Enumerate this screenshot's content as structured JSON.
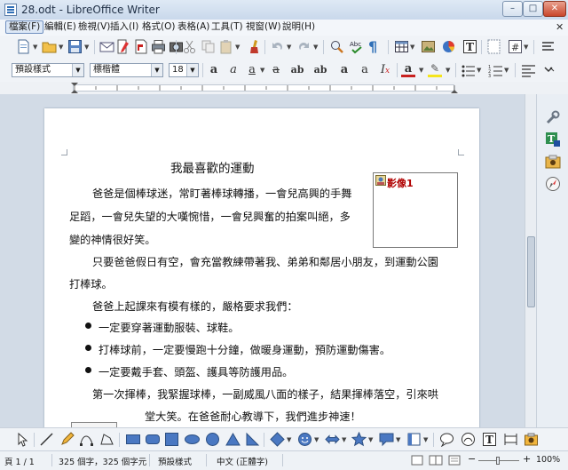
{
  "window": {
    "title": "28.odt - LibreOffice Writer",
    "controls": {
      "minimize": "–",
      "maximize": "□",
      "close": "✕"
    },
    "doc_close": "✕"
  },
  "menu": [
    "檔案(F)",
    "編輯(E)",
    "檢視(V)",
    "插入(I)",
    "格式(O)",
    "表格(A)",
    "工具(T)",
    "視窗(W)",
    "說明(H)"
  ],
  "formatting": {
    "paragraph_style": "預設樣式",
    "font_name": "標楷體",
    "font_size": "18"
  },
  "document": {
    "title": "我最喜歡的運動",
    "lines": [
      "爸爸是個棒球迷，常盯著棒球轉播，一會兒高興的手舞",
      "足蹈，一會兒失望的大嘆惋惜，一會兒興奮的拍案叫絕，多",
      "變的神情很好笑。",
      "只要爸爸假日有空，會充當教練帶著我、弟弟和鄰居小朋友，到運動公園",
      "打棒球。",
      "爸爸上起課來有模有樣的，嚴格要求我們：",
      "一定要穿著運動服裝、球鞋。",
      "打棒球前，一定要慢跑十分鐘，做暖身運動，預防運動傷害。",
      "一定要戴手套、頭盔、護具等防護用品。",
      "第一次揮棒，我緊握球棒，一副威風八面的樣子，結果揮棒落空，引來哄",
      "堂大笑。在爸爸耐心教導下，我們進步神速！"
    ],
    "frame_label": "影像1"
  },
  "status": {
    "page": "頁 1 / 1",
    "word_count": "325 個字，325 個字元",
    "page_style": "預設樣式",
    "language": "中文 (正體字)",
    "zoom": "100%"
  }
}
